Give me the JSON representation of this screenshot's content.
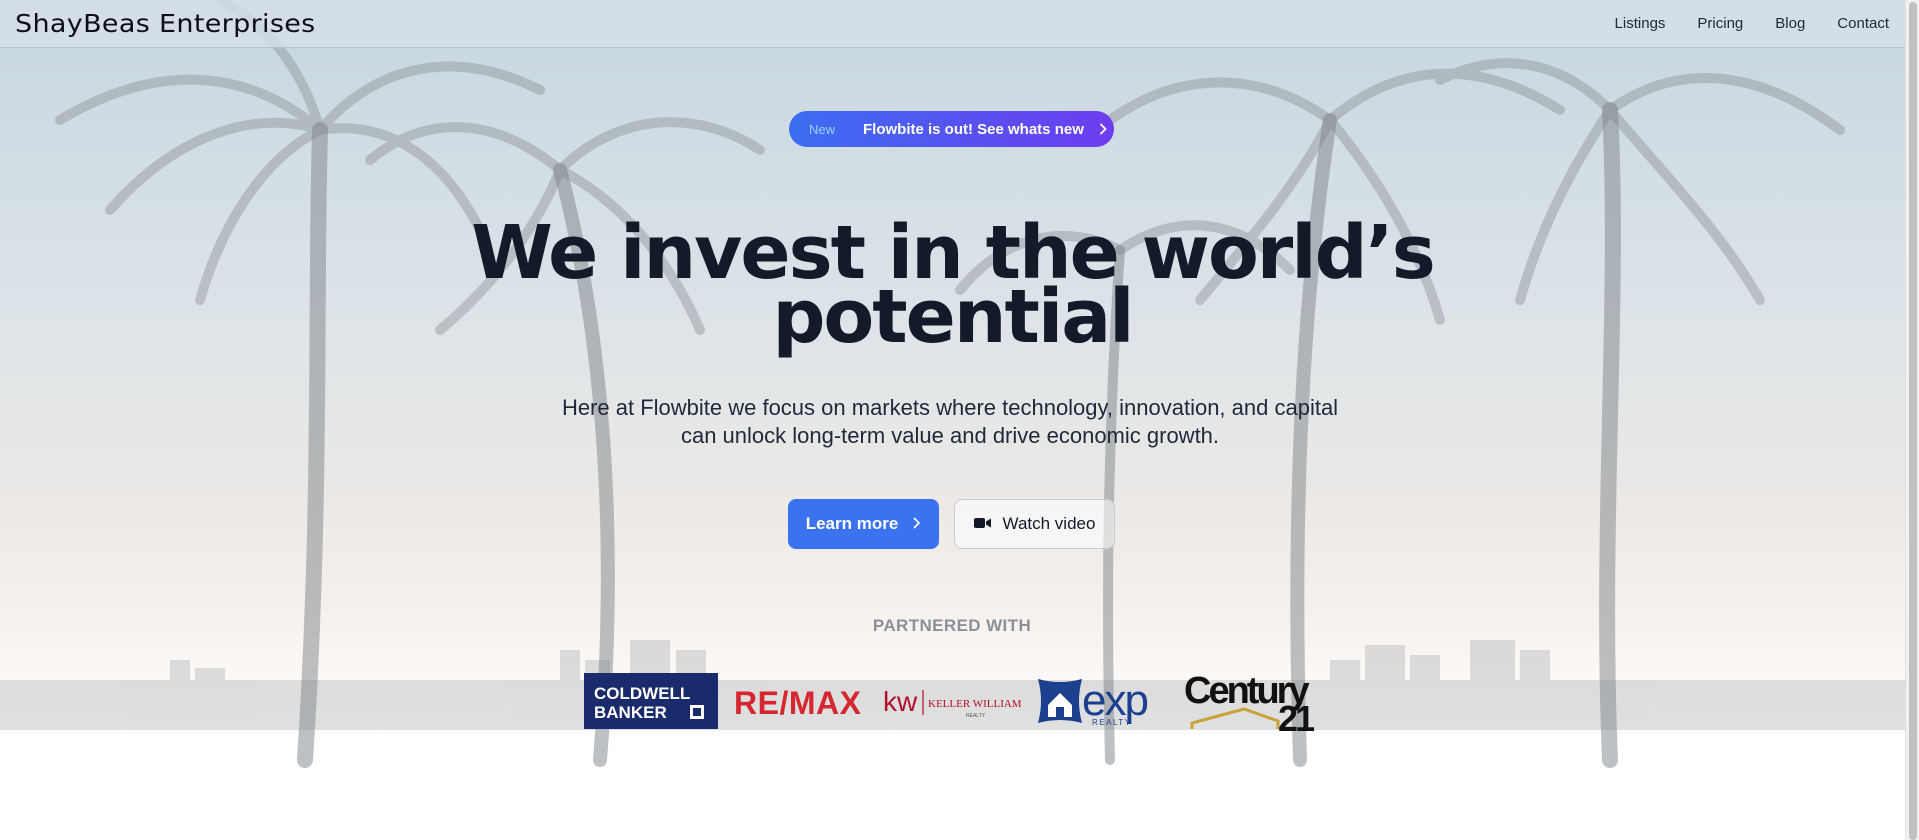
{
  "nav": {
    "brand": "ShayBeas Enterprises",
    "links": [
      "Listings",
      "Pricing",
      "Blog",
      "Contact"
    ]
  },
  "announcement": {
    "badge": "New",
    "text": "Flowbite is out! See whats new",
    "icon": "chevron-right-icon"
  },
  "hero": {
    "headline_line1": "We invest in the world’s",
    "headline_line2": "potential",
    "subtitle_line1": "Here at Flowbite we focus on markets where technology, innovation, and capital",
    "subtitle_line2": "can unlock long-term value and drive economic growth.",
    "primary_button": "Learn more",
    "secondary_button": "Watch video"
  },
  "partners": {
    "heading": "PARTNERED WITH",
    "logos": [
      {
        "name": "coldwell-banker",
        "text1": "COLDWELL",
        "text2": "BANKER"
      },
      {
        "name": "remax",
        "text": "RE/MAX"
      },
      {
        "name": "keller-williams",
        "text1": "kw",
        "text2": "KELLER WILLIAMS",
        "text3": "REALTY"
      },
      {
        "name": "exp-realty",
        "text1": "exp",
        "text2": "REALTY"
      },
      {
        "name": "century-21",
        "text1": "Century",
        "text2": "21"
      }
    ]
  },
  "colors": {
    "primary": "#3b72f0",
    "announce_start": "#3b6df2",
    "announce_end": "#6d3df0",
    "headline": "#131a2a",
    "coldwell_navy": "#1a2b6b",
    "remax_red": "#d6262f",
    "kw_red": "#b40f2a",
    "exp_blue": "#1c3f8f",
    "century_gold": "#c9a23a"
  }
}
